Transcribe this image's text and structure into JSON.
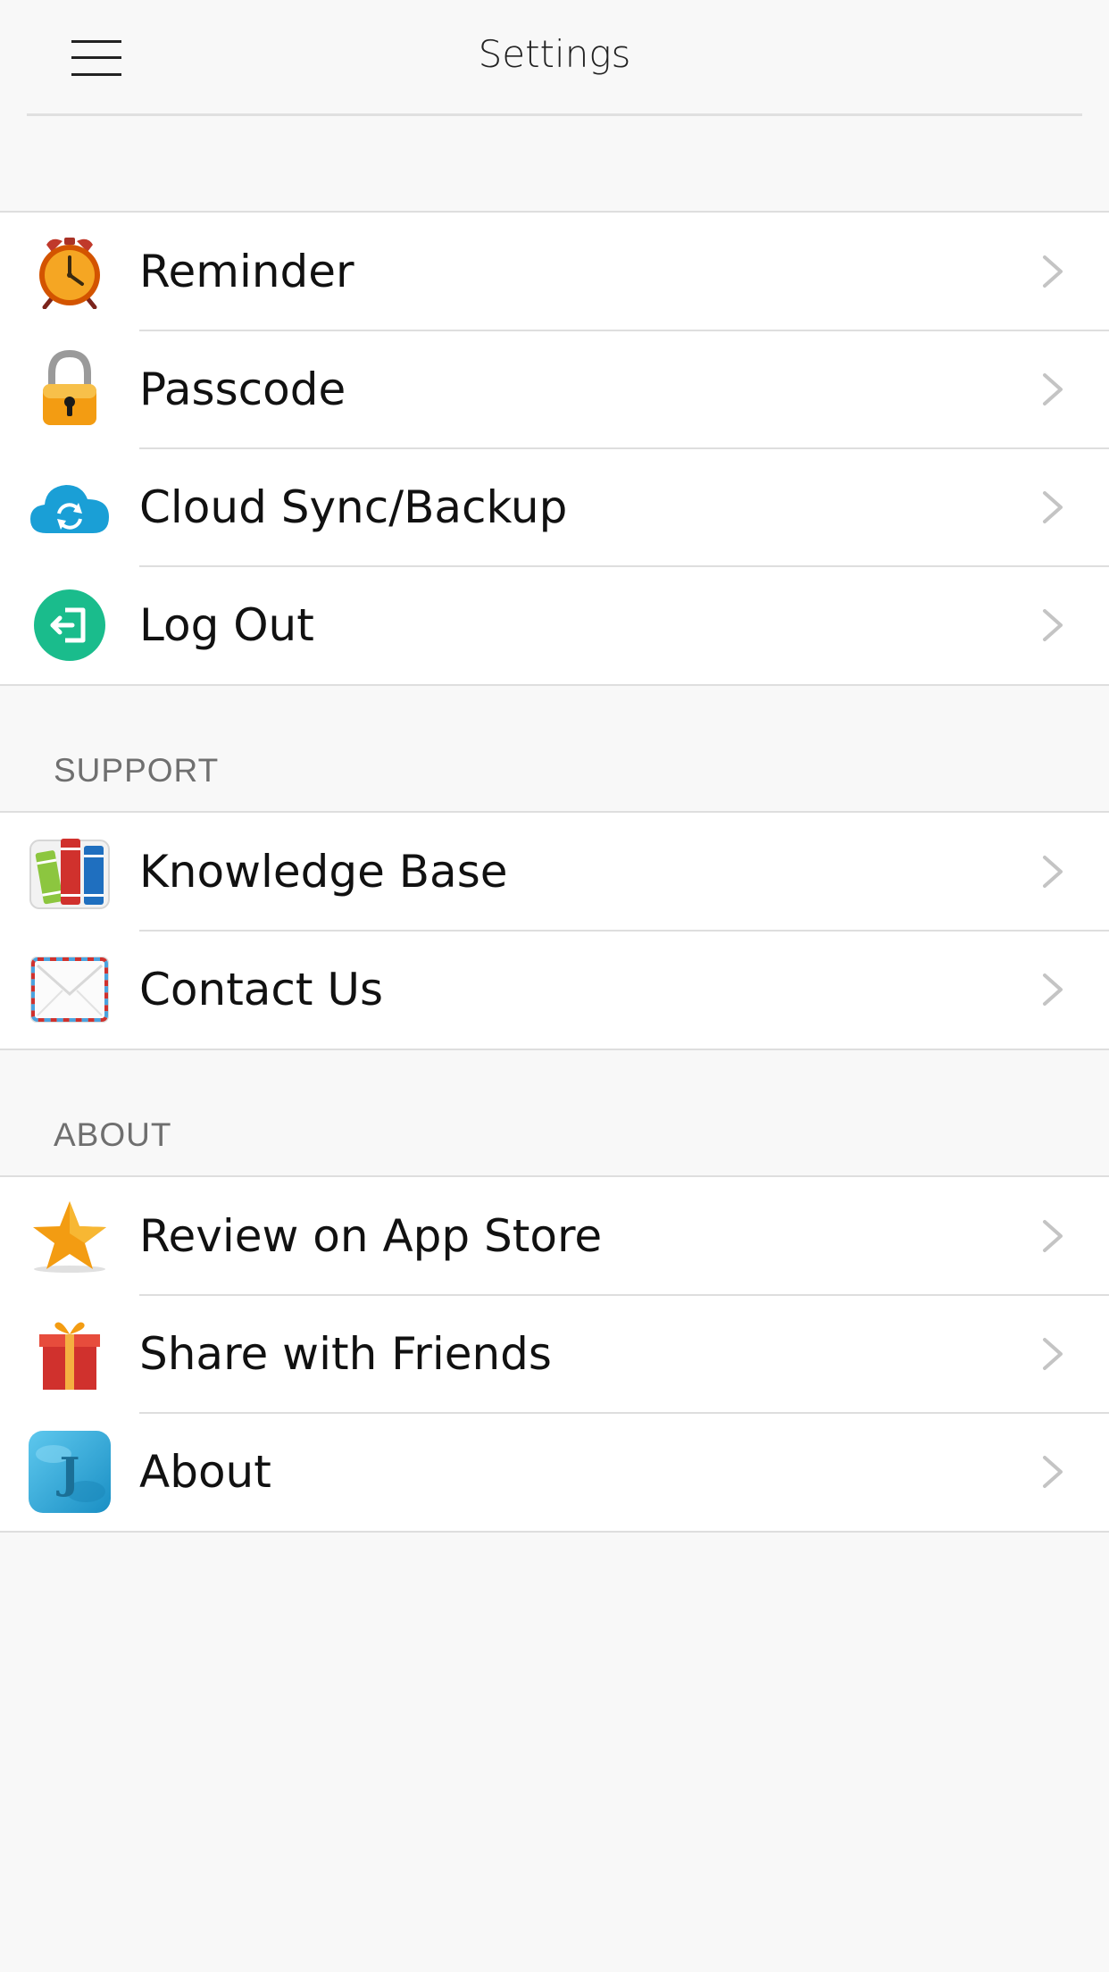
{
  "navbar": {
    "title": "Settings",
    "menu_icon": "hamburger-menu-icon"
  },
  "groups": [
    {
      "header": "",
      "items": [
        {
          "label": "Reminder",
          "icon": "alarm-clock-icon"
        },
        {
          "label": "Passcode",
          "icon": "lock-icon"
        },
        {
          "label": "Cloud Sync/Backup",
          "icon": "cloud-sync-icon"
        },
        {
          "label": "Log Out",
          "icon": "logout-icon"
        }
      ]
    },
    {
      "header": "SUPPORT",
      "items": [
        {
          "label": "Knowledge Base",
          "icon": "books-icon"
        },
        {
          "label": "Contact Us",
          "icon": "envelope-icon"
        }
      ]
    },
    {
      "header": "ABOUT",
      "items": [
        {
          "label": "Review on App Store",
          "icon": "star-icon"
        },
        {
          "label": "Share with Friends",
          "icon": "gift-icon"
        },
        {
          "label": "About",
          "icon": "app-logo-icon"
        }
      ]
    }
  ],
  "app_logo_letter": "J",
  "colors": {
    "background": "#f8f8f8",
    "row_background": "#ffffff",
    "separator": "#dedede",
    "header_text": "#6f6f6f",
    "chevron": "#c4c4c4"
  }
}
